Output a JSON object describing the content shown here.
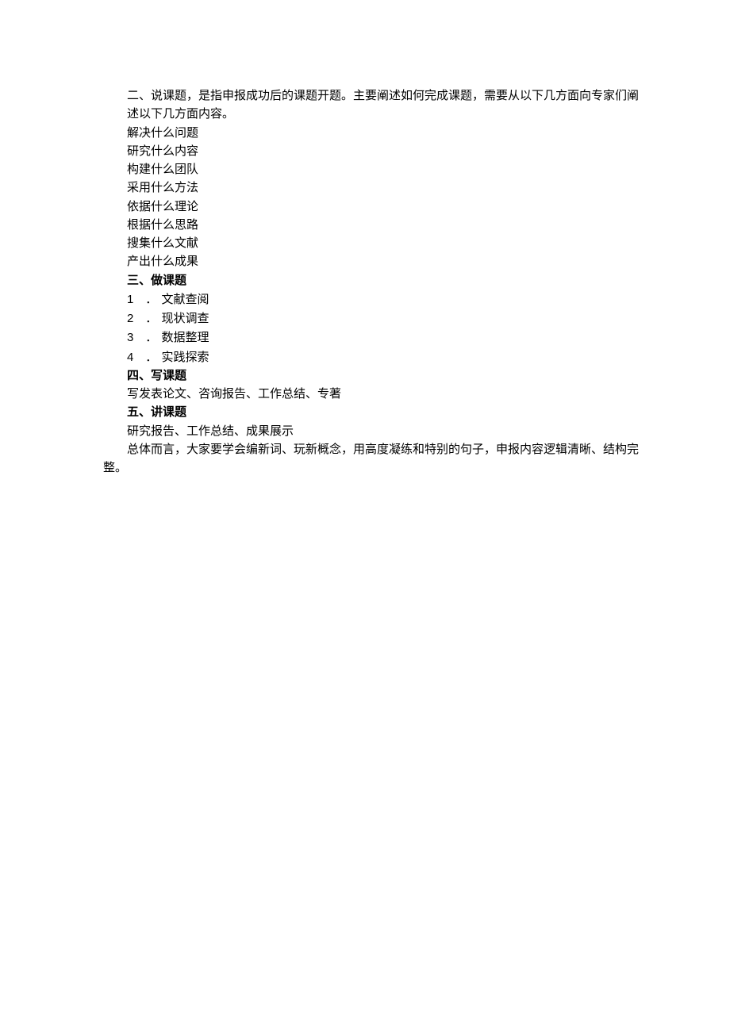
{
  "section2": {
    "intro": "二、说课题，是指申报成功后的课题开题。主要阐述如何完成课题，需要从以下几方面向专家们阐述以下几方面内容。",
    "items": [
      "解决什么问题",
      "研究什么内容",
      "构建什么团队",
      "采用什么方法",
      "依据什么理论",
      "根据什么思路",
      "搜集什么文献",
      "产出什么成果"
    ]
  },
  "section3": {
    "heading": "三、做课题",
    "items": [
      {
        "num": "1",
        "dot": "．",
        "text": "文献查阅"
      },
      {
        "num": "2",
        "dot": "．",
        "text": "现状调查"
      },
      {
        "num": "3",
        "dot": "．",
        "text": "数据整理"
      },
      {
        "num": "4",
        "dot": "．",
        "text": "实践探索"
      }
    ]
  },
  "section4": {
    "heading": "四、写课题",
    "body": "写发表论文、咨询报告、工作总结、专著"
  },
  "section5": {
    "heading": "五、讲课题",
    "body": "研究报告、工作总结、成果展示"
  },
  "conclusion": "总体而言，大家要学会编新词、玩新概念，用高度凝练和特别的句子，申报内容逻辑清晰、结构完整。"
}
